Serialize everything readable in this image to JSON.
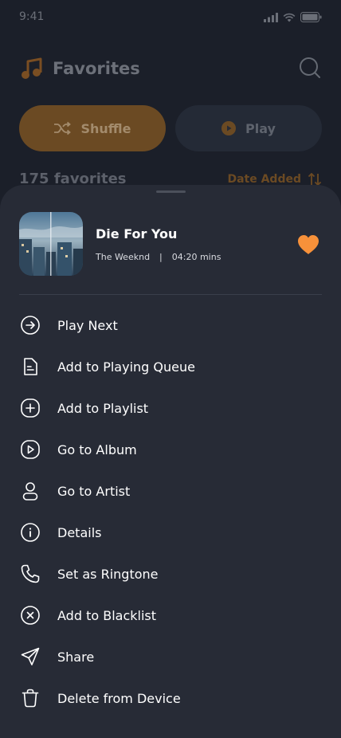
{
  "status": {
    "time": "9:41"
  },
  "header": {
    "title": "Favorites",
    "title_icon": "music-note-icon",
    "search_icon": "search-icon"
  },
  "actions": {
    "shuffle_label": "Shuffle",
    "play_label": "Play"
  },
  "list_info": {
    "count_text": "175 favorites",
    "sort_label": "Date Added"
  },
  "colors": {
    "accent": "#f7913a",
    "sheet_bg": "#272b36",
    "page_bg": "#1b1f29"
  },
  "track": {
    "title": "Die For You",
    "artist": "The Weeknd",
    "separator": "|",
    "duration": "04:20 mins",
    "favorite_icon": "heart-icon"
  },
  "menu": [
    {
      "label": "Play Next",
      "icon": "arrow-right-circle-icon"
    },
    {
      "label": "Add to Playing Queue",
      "icon": "queue-icon"
    },
    {
      "label": "Add to Playlist",
      "icon": "plus-square-icon"
    },
    {
      "label": "Go to Album",
      "icon": "play-square-icon"
    },
    {
      "label": "Go to Artist",
      "icon": "user-icon"
    },
    {
      "label": "Details",
      "icon": "info-icon"
    },
    {
      "label": "Set as Ringtone",
      "icon": "phone-icon"
    },
    {
      "label": "Add to Blacklist",
      "icon": "close-circle-icon"
    },
    {
      "label": "Share",
      "icon": "send-icon"
    },
    {
      "label": "Delete from Device",
      "icon": "trash-icon"
    }
  ]
}
